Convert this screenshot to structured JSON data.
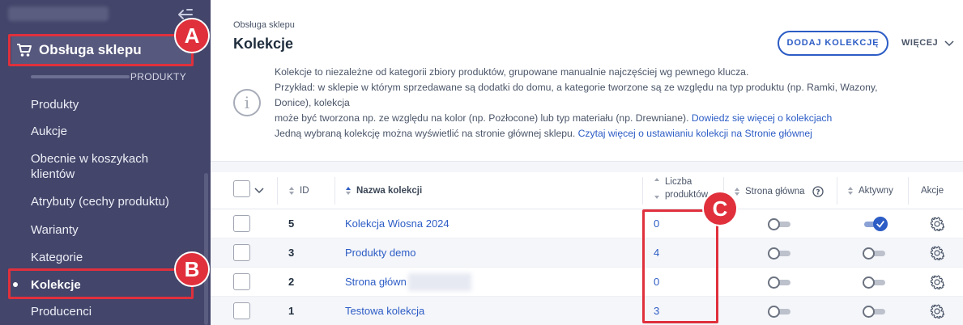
{
  "sidebar": {
    "section_label": "Obsługa sklepu",
    "subheading": "PRODUKTY",
    "items": [
      {
        "label": "Produkty"
      },
      {
        "label": "Aukcje"
      },
      {
        "label": "Obecnie w koszykach klientów"
      },
      {
        "label": "Atrybuty (cechy produktu)"
      },
      {
        "label": "Warianty"
      },
      {
        "label": "Kategorie"
      },
      {
        "label": "Kolekcje",
        "active": true
      },
      {
        "label": "Producenci"
      }
    ]
  },
  "callouts": {
    "a": "A",
    "b": "B",
    "c": "C"
  },
  "header": {
    "breadcrumb": "Obsługa sklepu",
    "title": "Kolekcje",
    "add_button": "DODAJ KOLEKCJĘ",
    "more_button": "WIĘCEJ"
  },
  "info": {
    "line1": "Kolekcje to niezależne od kategorii zbiory produktów, grupowane manualnie najczęściej wg pewnego klucza.",
    "line2": "Przykład: w sklepie w którym sprzedawane są dodatki do domu, a kategorie tworzone są ze względu na typ produktu (np. Ramki, Wazony,",
    "line3": "Donice), kolekcja",
    "line4": "może być tworzona np. ze względu na kolor (np. Pozłocone) lub typ materiału (np. Drewniane).",
    "link1": "Dowiedz się więcej o kolekcjach",
    "line5": "Jedną wybraną kolekcję można wyświetlić na stronie głównej sklepu.",
    "link2": "Czytaj więcej o ustawianiu kolekcji na Stronie głównej"
  },
  "table": {
    "columns": {
      "id": "ID",
      "name": "Nazwa kolekcji",
      "count_line1": "Liczba",
      "count_line2": "produktów",
      "homepage": "Strona główna",
      "active": "Aktywny",
      "actions": "Akcje"
    },
    "rows": [
      {
        "id": "5",
        "name": "Kolekcja Wiosna 2024",
        "count": "0",
        "homepage": false,
        "active": true
      },
      {
        "id": "3",
        "name": "Produkty demo",
        "count": "4",
        "homepage": false,
        "active": false
      },
      {
        "id": "2",
        "name": "Strona główn",
        "count": "0",
        "homepage": false,
        "active": false
      },
      {
        "id": "1",
        "name": "Testowa kolekcja",
        "count": "3",
        "homepage": false,
        "active": false
      }
    ]
  },
  "colors": {
    "sidebar_bg": "#43456a",
    "accent": "#2c5cc5",
    "callout": "#e0303c"
  },
  "icons": [
    "collapse-arrow-icon",
    "cart-icon",
    "info-icon",
    "chevron-down-icon",
    "sort-icon",
    "help-icon",
    "gear-icon",
    "check-icon"
  ]
}
